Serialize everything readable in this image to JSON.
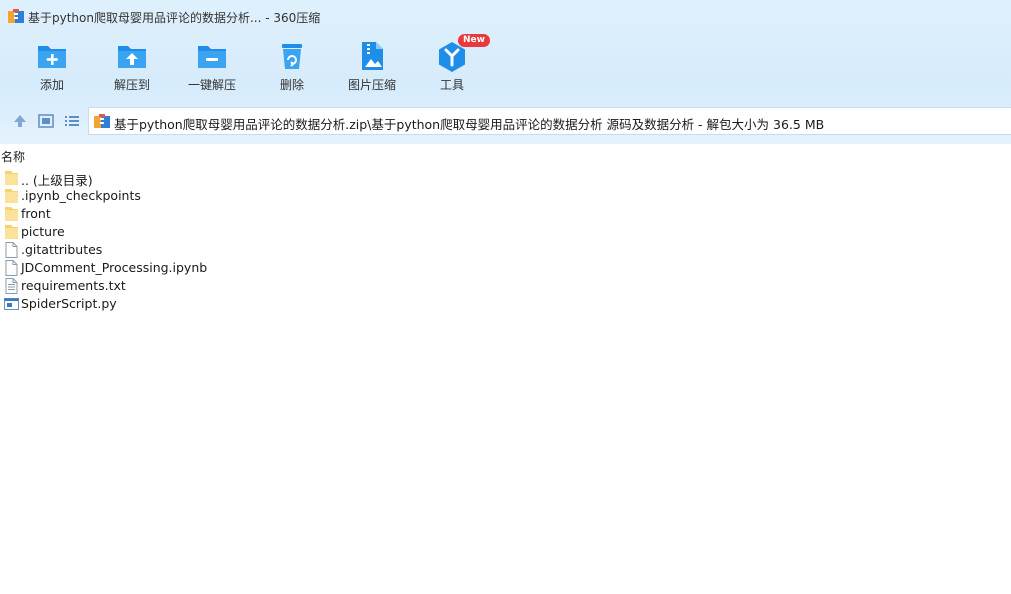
{
  "window": {
    "title": "基于python爬取母婴用品评论的数据分析... - 360压缩"
  },
  "toolbar": {
    "items": [
      {
        "label": "添加",
        "icon": "add-folder-icon"
      },
      {
        "label": "解压到",
        "icon": "extract-to-icon"
      },
      {
        "label": "一键解压",
        "icon": "one-click-extract-icon"
      },
      {
        "label": "删除",
        "icon": "recycle-bin-icon"
      },
      {
        "label": "图片压缩",
        "icon": "image-compress-icon"
      },
      {
        "label": "工具",
        "icon": "tools-icon",
        "badge": "New"
      }
    ]
  },
  "navigation": {
    "path": "基于python爬取母婴用品评论的数据分析.zip\\基于python爬取母婴用品评论的数据分析 源码及数据分析 - 解包大小为 36.5 MB"
  },
  "list": {
    "column_name": "名称",
    "items": [
      {
        "name": ".. (上级目录)",
        "type": "folder"
      },
      {
        "name": ".ipynb_checkpoints",
        "type": "folder"
      },
      {
        "name": "front",
        "type": "folder"
      },
      {
        "name": "picture",
        "type": "folder"
      },
      {
        "name": ".gitattributes",
        "type": "file"
      },
      {
        "name": "JDComment_Processing.ipynb",
        "type": "file"
      },
      {
        "name": "requirements.txt",
        "type": "text"
      },
      {
        "name": "SpiderScript.py",
        "type": "python"
      }
    ]
  },
  "colors": {
    "accent": "#1f8ee8",
    "chrome_bg": "#dcedfc",
    "badge": "#e8393d"
  }
}
